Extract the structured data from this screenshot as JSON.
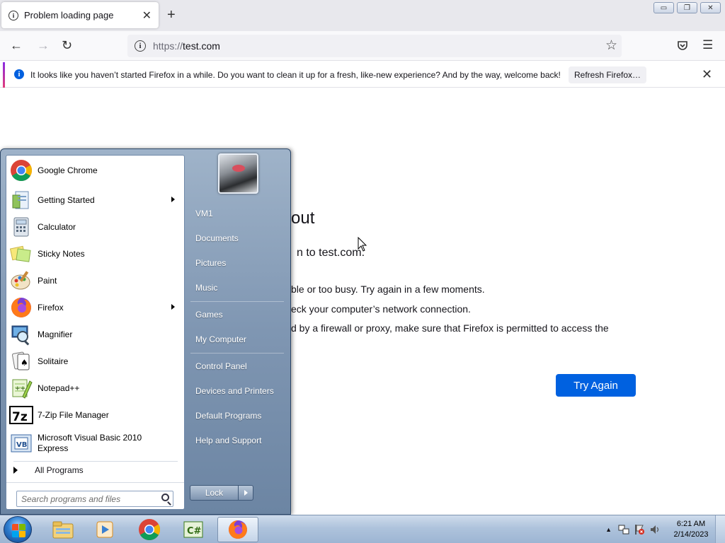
{
  "browser": {
    "tab_title": "Problem loading page",
    "url_protocol": "https://",
    "url_host": "test.com",
    "notification": "It looks like you haven’t started Firefox in a while. Do you want to clean it up for a fresh, like-new experience? And by the way, welcome back!",
    "refresh_label": "Refresh Firefox…"
  },
  "page": {
    "title": "out",
    "subtitle": "n to test.com.",
    "items": [
      "ble or too busy. Try again in a few moments.",
      "eck your computer’s network connection.",
      "d by a firewall or proxy, make sure that Firefox is permitted to access the"
    ],
    "try_again": "Try Again"
  },
  "start_menu": {
    "programs": [
      {
        "label": "Google Chrome",
        "icon": "chrome-icon",
        "submenu": false
      },
      {
        "label": "Getting Started",
        "icon": "getting-started-icon",
        "submenu": true
      },
      {
        "label": "Calculator",
        "icon": "calculator-icon",
        "submenu": false
      },
      {
        "label": "Sticky Notes",
        "icon": "sticky-notes-icon",
        "submenu": false
      },
      {
        "label": "Paint",
        "icon": "paint-icon",
        "submenu": false
      },
      {
        "label": "Firefox",
        "icon": "firefox-icon",
        "submenu": true
      },
      {
        "label": "Magnifier",
        "icon": "magnifier-icon",
        "submenu": false
      },
      {
        "label": "Solitaire",
        "icon": "solitaire-icon",
        "submenu": false
      },
      {
        "label": "Notepad++",
        "icon": "notepad-plus-plus-icon",
        "submenu": false
      },
      {
        "label": "7-Zip File Manager",
        "icon": "7zip-icon",
        "submenu": false
      },
      {
        "label": "Microsoft Visual Basic 2010 Express",
        "icon": "visual-basic-icon",
        "submenu": false
      }
    ],
    "all_programs": "All Programs",
    "search_placeholder": "Search programs and files",
    "right_items": [
      "VM1",
      "Documents",
      "Pictures",
      "Music",
      "Games",
      "My Computer",
      "Control Panel",
      "Devices and Printers",
      "Default Programs",
      "Help and Support"
    ],
    "lock_label": "Lock"
  },
  "taskbar": {
    "items": [
      "windows-explorer-icon",
      "media-player-icon",
      "chrome-icon",
      "csharp-express-icon",
      "firefox-icon"
    ],
    "active": "firefox-icon",
    "time": "6:21 AM",
    "date": "2/14/2023"
  },
  "colors": {
    "firefox_blue": "#0061e0",
    "notification_icon": "#0060df"
  }
}
